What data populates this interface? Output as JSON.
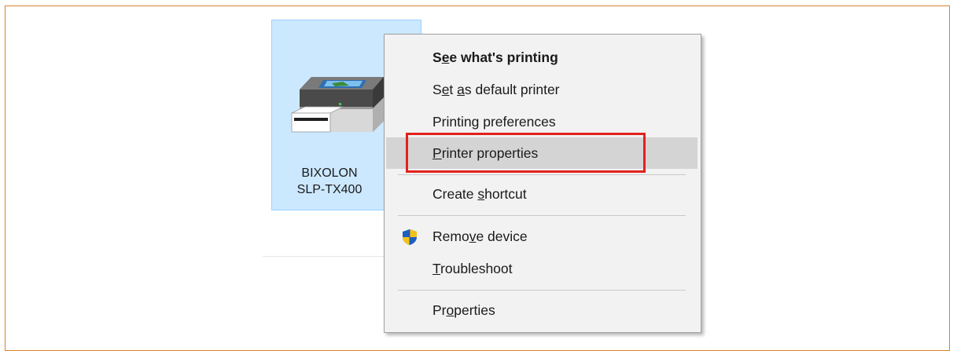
{
  "device": {
    "name_line1": "BIXOLON",
    "name_line2": "SLP-TX400",
    "icon": "printer-icon"
  },
  "context_menu": {
    "items": [
      {
        "pre": "S",
        "ul": "e",
        "post": "e what's printing",
        "bold": true
      },
      {
        "pre": "S",
        "ul": "e",
        "post": "t ",
        "ul2": "a",
        "post2": "s default printer"
      },
      {
        "pre": "Printin",
        "ul": "g",
        "post": " preferences"
      },
      {
        "pre": "",
        "ul": "P",
        "post": "rinter properties",
        "hovered": true
      },
      {
        "pre": "Create ",
        "ul": "s",
        "post": "hortcut"
      },
      {
        "pre": "Remo",
        "ul": "v",
        "post": "e device",
        "icon": "uac-shield-icon"
      },
      {
        "pre": "",
        "ul": "T",
        "post": "roubleshoot"
      },
      {
        "pre": "Pr",
        "ul": "o",
        "post": "perties"
      }
    ]
  },
  "colors": {
    "frame_border": "#d9822b",
    "selection_fill": "#cce8ff",
    "highlight_box": "#e2211c",
    "menu_bg": "#f2f2f2",
    "menu_hover": "#d4d4d4"
  }
}
